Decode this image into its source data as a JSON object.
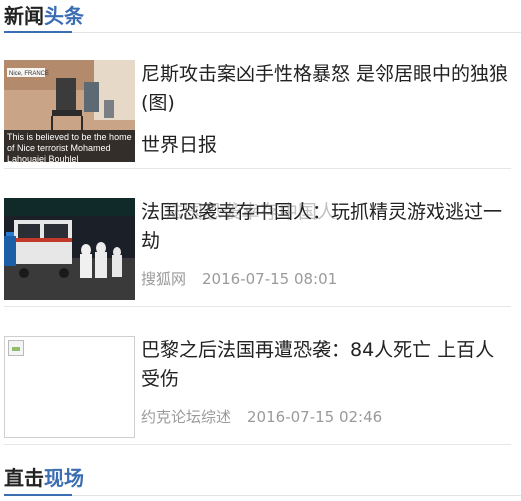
{
  "sections": {
    "headlines": {
      "part1": "新闻",
      "part2": "头条"
    },
    "live": {
      "part1": "直击",
      "part2": "现场"
    }
  },
  "articles": [
    {
      "title": "尼斯攻击案凶手性格暴怒 是邻居眼中的独狼(图)",
      "source": "世界日报",
      "time": "",
      "thumb": {
        "overlay_tag": "Nice, FRANCE",
        "caption": "This is believed to be the home of Nice terrorist Mohamed Lahouaiej Bouhlel"
      }
    },
    {
      "title": "法国恐袭幸存中国人：玩抓精灵游戏逃过一劫",
      "ghost_text": "法国恐袭幸存中国人",
      "source": "搜狐网",
      "time": "2016-07-15 08:01"
    },
    {
      "title": "巴黎之后法国再遭恐袭：84人死亡 上百人受伤",
      "source": "约克论坛综述",
      "time": "2016-07-15 02:46",
      "thumb": {
        "broken": true
      }
    }
  ]
}
